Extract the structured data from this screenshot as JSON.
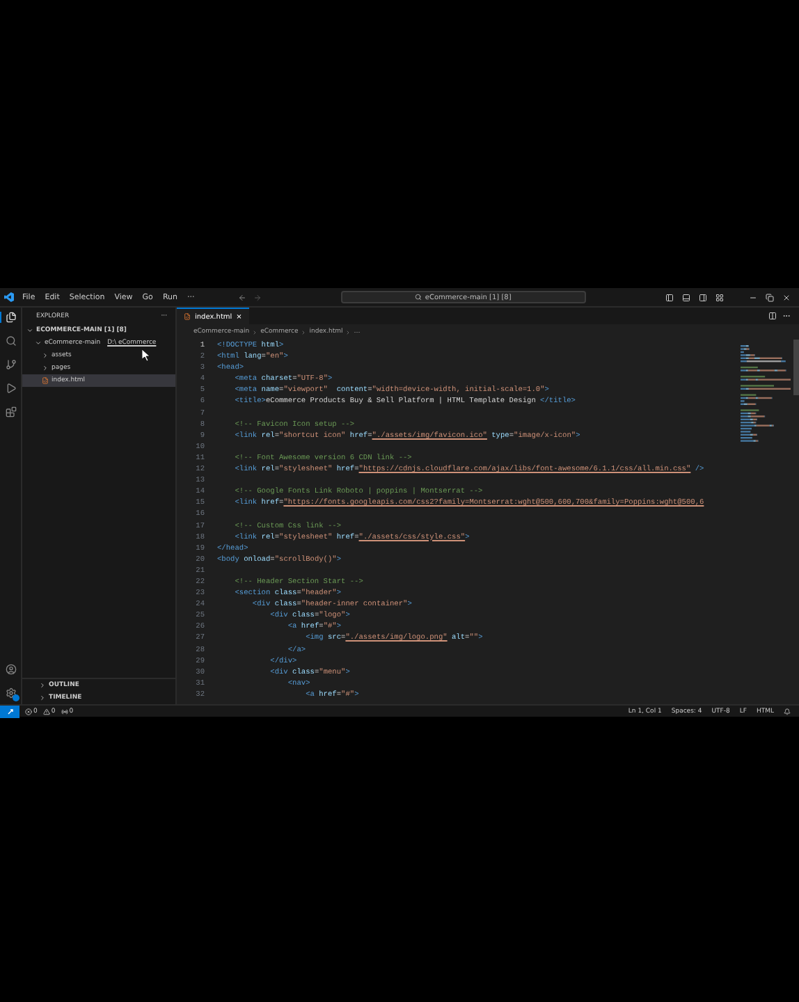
{
  "title_bar": {
    "menus": [
      "File",
      "Edit",
      "Selection",
      "View",
      "Go",
      "Run",
      "···"
    ],
    "search": "eCommerce-main [1] [8]"
  },
  "activity_bar": {
    "items": [
      {
        "kind": "files",
        "selected": true
      },
      {
        "kind": "search",
        "selected": false
      },
      {
        "kind": "source-control",
        "selected": false
      },
      {
        "kind": "run",
        "selected": false
      },
      {
        "kind": "extensions",
        "selected": false
      }
    ],
    "settings_badge": true
  },
  "sidebar": {
    "title": "EXPLORER",
    "more": "···",
    "workspace": "ECOMMERCE-MAIN [1] [8]",
    "tree": [
      {
        "label": "eCommerce-main",
        "hint": "D:\\ eCommerce",
        "expanded": true,
        "selected": false,
        "children": [
          {
            "label": "assets",
            "kind": "folder",
            "expanded": false,
            "selected": false
          },
          {
            "label": "pages",
            "kind": "folder",
            "expanded": false,
            "selected": false
          },
          {
            "label": "index.html",
            "kind": "file",
            "selected": true
          }
        ]
      }
    ],
    "panels": [
      {
        "label": "OUTLINE",
        "expanded": false
      },
      {
        "label": "TIMELINE",
        "expanded": false
      }
    ]
  },
  "editor": {
    "tabs": [
      {
        "label": "index.html",
        "selected": true,
        "close": "×"
      }
    ],
    "breadcrumb": [
      "eCommerce-main",
      "eCommerce",
      "index.html",
      "…"
    ],
    "lines": [
      {
        "number": "1",
        "tokens": [
          {
            "kind": "tag",
            "text": "<!DOCTYPE "
          },
          {
            "kind": "attr",
            "text": "html"
          },
          {
            "kind": "tag",
            "text": ">"
          }
        ]
      },
      {
        "number": "2",
        "tokens": [
          {
            "kind": "tag",
            "text": "<html "
          },
          {
            "kind": "attr",
            "text": "lang"
          },
          {
            "kind": "text",
            "text": "="
          },
          {
            "kind": "str",
            "text": "\"en\""
          },
          {
            "kind": "tag",
            "text": ">"
          }
        ]
      },
      {
        "number": "3",
        "tokens": [
          {
            "kind": "tag",
            "text": "<head>"
          }
        ]
      },
      {
        "number": "4",
        "tokens": [
          {
            "kind": "tag",
            "text": "    <meta "
          },
          {
            "kind": "attr",
            "text": "charset"
          },
          {
            "kind": "text",
            "text": "="
          },
          {
            "kind": "str",
            "text": "\"UTF-8\""
          },
          {
            "kind": "tag",
            "text": ">"
          }
        ]
      },
      {
        "number": "5",
        "tokens": [
          {
            "kind": "tag",
            "text": "    <meta "
          },
          {
            "kind": "attr",
            "text": "name"
          },
          {
            "kind": "text",
            "text": "="
          },
          {
            "kind": "str",
            "text": "\"viewport\""
          },
          {
            "kind": "attr",
            "text": "  content"
          },
          {
            "kind": "text",
            "text": "="
          },
          {
            "kind": "str",
            "text": "\"width=device-width, initial-scale=1.0\""
          },
          {
            "kind": "tag",
            "text": ">"
          }
        ]
      },
      {
        "number": "6",
        "tokens": [
          {
            "kind": "tag",
            "text": "    <title>"
          },
          {
            "kind": "text",
            "text": "eCommerce Products Buy & Sell Platform | HTML Template Design "
          },
          {
            "kind": "tag",
            "text": "</title>"
          }
        ]
      },
      {
        "number": "7"
      },
      {
        "number": "8",
        "tokens": [
          {
            "kind": "comment",
            "text": "    <!-- Favicon Icon setup -->"
          }
        ]
      },
      {
        "number": "9",
        "tokens": [
          {
            "kind": "tag",
            "text": "    <link "
          },
          {
            "kind": "attr",
            "text": "rel"
          },
          {
            "kind": "text",
            "text": "="
          },
          {
            "kind": "str",
            "text": "\"shortcut icon\" "
          },
          {
            "kind": "attr",
            "text": "href"
          },
          {
            "kind": "text",
            "text": "="
          },
          {
            "kind": "link",
            "text": "\"./assets/img/favicon.ico\""
          },
          {
            "kind": "attr",
            "text": " type"
          },
          {
            "kind": "text",
            "text": "="
          },
          {
            "kind": "str",
            "text": "\"image/x-icon\""
          },
          {
            "kind": "tag",
            "text": ">"
          }
        ]
      },
      {
        "number": "10"
      },
      {
        "number": "11",
        "tokens": [
          {
            "kind": "comment",
            "text": "    <!-- Font Awesome version 6 CDN link -->"
          }
        ]
      },
      {
        "number": "12",
        "tokens": [
          {
            "kind": "tag",
            "text": "    <link "
          },
          {
            "kind": "attr",
            "text": "rel"
          },
          {
            "kind": "text",
            "text": "="
          },
          {
            "kind": "str",
            "text": "\"stylesheet\" "
          },
          {
            "kind": "attr",
            "text": "href"
          },
          {
            "kind": "text",
            "text": "="
          },
          {
            "kind": "link",
            "text": "\"https://cdnjs.cloudflare.com/ajax/libs/font-awesome/6.1.1/css/all.min.css\""
          },
          {
            "kind": "tag",
            "text": " />"
          }
        ]
      },
      {
        "number": "13"
      },
      {
        "number": "14",
        "tokens": [
          {
            "kind": "comment",
            "text": "    <!-- Google Fonts Link Roboto | poppins | Montserrat -->"
          }
        ]
      },
      {
        "number": "15",
        "tokens": [
          {
            "kind": "tag",
            "text": "    <link "
          },
          {
            "kind": "attr",
            "text": "href"
          },
          {
            "kind": "text",
            "text": "="
          },
          {
            "kind": "link",
            "text": "\"https://fonts.googleapis.com/css2?family=Montserrat:wght@500,600,700&family=Poppins:wght@500,6"
          }
        ]
      },
      {
        "number": "16"
      },
      {
        "number": "17",
        "tokens": [
          {
            "kind": "comment",
            "text": "    <!-- Custom Css link -->"
          }
        ]
      },
      {
        "number": "18",
        "tokens": [
          {
            "kind": "tag",
            "text": "    <link "
          },
          {
            "kind": "attr",
            "text": "rel"
          },
          {
            "kind": "text",
            "text": "="
          },
          {
            "kind": "str",
            "text": "\"stylesheet\" "
          },
          {
            "kind": "attr",
            "text": "href"
          },
          {
            "kind": "text",
            "text": "="
          },
          {
            "kind": "link",
            "text": "\"./assets/css/style.css\""
          },
          {
            "kind": "tag",
            "text": ">"
          }
        ]
      },
      {
        "number": "19",
        "tokens": [
          {
            "kind": "tag",
            "text": "</head>"
          }
        ]
      },
      {
        "number": "20",
        "tokens": [
          {
            "kind": "tag",
            "text": "<body "
          },
          {
            "kind": "attr",
            "text": "onload"
          },
          {
            "kind": "text",
            "text": "="
          },
          {
            "kind": "str",
            "text": "\"scrollBody()\""
          },
          {
            "kind": "tag",
            "text": ">"
          }
        ]
      },
      {
        "number": "21"
      },
      {
        "number": "22",
        "tokens": [
          {
            "kind": "comment",
            "text": "    <!-- Header Section Start -->"
          }
        ]
      },
      {
        "number": "23",
        "tokens": [
          {
            "kind": "tag",
            "text": "    <section "
          },
          {
            "kind": "attr",
            "text": "class"
          },
          {
            "kind": "text",
            "text": "="
          },
          {
            "kind": "str",
            "text": "\"header\""
          },
          {
            "kind": "tag",
            "text": ">"
          }
        ]
      },
      {
        "number": "24",
        "tokens": [
          {
            "kind": "tag",
            "text": "        <div "
          },
          {
            "kind": "attr",
            "text": "class"
          },
          {
            "kind": "text",
            "text": "="
          },
          {
            "kind": "str",
            "text": "\"header-inner container\""
          },
          {
            "kind": "tag",
            "text": ">"
          }
        ]
      },
      {
        "number": "25",
        "tokens": [
          {
            "kind": "tag",
            "text": "            <div "
          },
          {
            "kind": "attr",
            "text": "class"
          },
          {
            "kind": "text",
            "text": "="
          },
          {
            "kind": "str",
            "text": "\"logo\""
          },
          {
            "kind": "tag",
            "text": ">"
          }
        ]
      },
      {
        "number": "26",
        "tokens": [
          {
            "kind": "tag",
            "text": "                <a "
          },
          {
            "kind": "attr",
            "text": "href"
          },
          {
            "kind": "text",
            "text": "="
          },
          {
            "kind": "str",
            "text": "\"#\""
          },
          {
            "kind": "tag",
            "text": ">"
          }
        ]
      },
      {
        "number": "27",
        "tokens": [
          {
            "kind": "tag",
            "text": "                    <img "
          },
          {
            "kind": "attr",
            "text": "src"
          },
          {
            "kind": "text",
            "text": "="
          },
          {
            "kind": "link",
            "text": "\"./assets/img/logo.png\""
          },
          {
            "kind": "attr",
            "text": " alt"
          },
          {
            "kind": "text",
            "text": "="
          },
          {
            "kind": "str",
            "text": "\"\""
          },
          {
            "kind": "tag",
            "text": ">"
          }
        ]
      },
      {
        "number": "28",
        "tokens": [
          {
            "kind": "tag",
            "text": "                </a>"
          }
        ]
      },
      {
        "number": "29",
        "tokens": [
          {
            "kind": "tag",
            "text": "            </div>"
          }
        ]
      },
      {
        "number": "30",
        "tokens": [
          {
            "kind": "tag",
            "text": "            <div "
          },
          {
            "kind": "attr",
            "text": "class"
          },
          {
            "kind": "text",
            "text": "="
          },
          {
            "kind": "str",
            "text": "\"menu\""
          },
          {
            "kind": "tag",
            "text": ">"
          }
        ]
      },
      {
        "number": "31",
        "tokens": [
          {
            "kind": "tag",
            "text": "                <nav>"
          }
        ]
      },
      {
        "number": "32",
        "tokens": [
          {
            "kind": "tag",
            "text": "                    <a "
          },
          {
            "kind": "attr",
            "text": "href"
          },
          {
            "kind": "text",
            "text": "="
          },
          {
            "kind": "str",
            "text": "\"#\""
          },
          {
            "kind": "tag",
            "text": ">"
          }
        ]
      }
    ]
  },
  "status_bar": {
    "left": [
      {
        "kind": "errors",
        "text": "0"
      },
      {
        "kind": "warnings",
        "text": "0"
      },
      {
        "kind": "ports",
        "text": "0"
      }
    ],
    "right": [
      "Ln 1, Col 1",
      "Spaces: 4",
      "UTF-8",
      "LF",
      "HTML"
    ]
  }
}
